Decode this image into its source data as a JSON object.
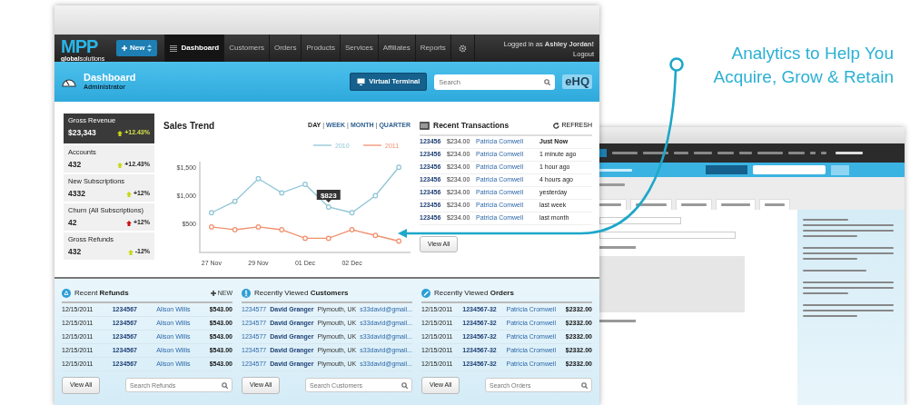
{
  "front_window": {
    "logo": {
      "mark": "MPP",
      "tagline": "**global**solutions"
    },
    "new_button": "New",
    "nav": [
      {
        "label": "Dashboard",
        "selected": true
      },
      {
        "label": "Customers",
        "selected": false
      },
      {
        "label": "Orders",
        "selected": false
      },
      {
        "label": "Products",
        "selected": false
      },
      {
        "label": "Services",
        "selected": false
      },
      {
        "label": "Affiliates",
        "selected": false
      },
      {
        "label": "Reports",
        "selected": false
      }
    ],
    "user": {
      "greeting": "Logged in as **Ashley Jordan!**",
      "logout": "Logout"
    },
    "header": {
      "title": "Dashboard",
      "subtitle": "Administrator",
      "terminal_button": "Virtual Terminal",
      "search_placeholder": "Search",
      "brand": "eHQ"
    },
    "stats": [
      {
        "label": "Gross Revenue",
        "value": "$23,343",
        "change": "+12.43%",
        "color": "#c8d814",
        "selected": true
      },
      {
        "label": "Accounts",
        "value": "432",
        "change": "+12.43%",
        "color": "#c8d814",
        "selected": false
      },
      {
        "label": "New Subscriptions",
        "value": "4332",
        "change": "+12%",
        "color": "#c8d814",
        "selected": false
      },
      {
        "label": "Churn (All Subscriptions)",
        "value": "42",
        "change": "+12%",
        "color": "#cc1111",
        "selected": false
      },
      {
        "label": "Gross Refunds",
        "value": "432",
        "change": "-12%",
        "color": "#c8d814",
        "selected": false
      }
    ],
    "sales_trend": {
      "title": "Sales Trend",
      "separator": "|",
      "periods": [
        {
          "label": "DAY",
          "selected": true
        },
        {
          "label": "WEEK",
          "selected": false
        },
        {
          "label": "MONTH",
          "selected": false
        },
        {
          "label": "QUARTER",
          "selected": false
        }
      ],
      "chart_data": {
        "type": "line",
        "categories": [
          "27 Nov",
          null,
          "29 Nov",
          null,
          "01 Dec",
          null,
          "02 Dec",
          null,
          null
        ],
        "ylim": [
          0,
          1600
        ],
        "legend": "upper right",
        "yticks": [
          {
            "value": 500,
            "label": "$500"
          },
          {
            "value": 1000,
            "label": "$1,000"
          },
          {
            "value": 1500,
            "label": "$1,500"
          }
        ],
        "series": [
          {
            "name": "2010",
            "color": "#8ec5d6",
            "marker": "circle",
            "values": [
              700,
              900,
              1300,
              1050,
              1200,
              800,
              700,
              1000,
              1500
            ]
          },
          {
            "name": "2011",
            "color": "#f0906e",
            "marker": "circle",
            "values": [
              450,
              400,
              450,
              400,
              250,
              250,
              400,
              300,
              200
            ]
          }
        ],
        "annotations": [
          "$823"
        ]
      }
    },
    "transactions": {
      "title": "Recent Transactions",
      "refresh": "REFRESH",
      "view_all": "View All",
      "rows": [
        {
          "id": "123456",
          "amount": "$234.00",
          "name": "Patricia Comwell",
          "time": "Just Now",
          "latest": true
        },
        {
          "id": "123456",
          "amount": "$234.00",
          "name": "Patricia Comwell",
          "time": "1 minute ago",
          "latest": false
        },
        {
          "id": "123456",
          "amount": "$234.00",
          "name": "Patricia Comwell",
          "time": "1 hour ago",
          "latest": false
        },
        {
          "id": "123456",
          "amount": "$234.00",
          "name": "Patricia Comwell",
          "time": "4 hours ago",
          "latest": false
        },
        {
          "id": "123456",
          "amount": "$234.00",
          "name": "Patricia Comwell",
          "time": "yesterday",
          "latest": false
        },
        {
          "id": "123456",
          "amount": "$234.00",
          "name": "Patricia Comwell",
          "time": "last week",
          "latest": false
        },
        {
          "id": "123456",
          "amount": "$234.00",
          "name": "Patricia Comwell",
          "time": "last month",
          "latest": false
        }
      ]
    },
    "panels": [
      {
        "kind": "refunds",
        "title": "Recent **Refunds**",
        "new_link": "NEW",
        "view_all": "View All",
        "search_placeholder": "Search Refunds",
        "rows": [
          [
            "12/15/2011",
            "1234567",
            "Alison Willis",
            "$543.00"
          ],
          [
            "12/15/2011",
            "1234567",
            "Alison Willis",
            "$543.00"
          ],
          [
            "12/15/2011",
            "1234567",
            "Alison Willis",
            "$543.00"
          ],
          [
            "12/15/2011",
            "1234567",
            "Alison Willis",
            "$543.00"
          ],
          [
            "12/15/2011",
            "1234567",
            "Alison Willis",
            "$543.00"
          ]
        ]
      },
      {
        "kind": "customers",
        "title": "Recently Viewed **Customers**",
        "view_all": "View All",
        "search_placeholder": "Search Customers",
        "rows": [
          [
            "1234577",
            "David Granger",
            "Plymouth, UK",
            "s33david@gmail..."
          ],
          [
            "1234577",
            "David Granger",
            "Plymouth, UK",
            "s33david@gmail..."
          ],
          [
            "1234577",
            "David Granger",
            "Plymouth, UK",
            "s33david@gmail..."
          ],
          [
            "1234577",
            "David Granger",
            "Plymouth, UK",
            "s33david@gmail..."
          ],
          [
            "1234577",
            "David Granger",
            "Plymouth, UK",
            "s33david@gmail..."
          ]
        ]
      },
      {
        "kind": "orders",
        "title": "Recently Viewed **Orders**",
        "view_all": "View All",
        "search_placeholder": "Search Orders",
        "rows": [
          [
            "12/15/2011",
            "1234567-32",
            "Patricia Cromwell",
            "$2332.00"
          ],
          [
            "12/15/2011",
            "1234567-32",
            "Patricia Cromwell",
            "$2332.00"
          ],
          [
            "12/15/2011",
            "1234567-32",
            "Patricia Cromwell",
            "$2332.00"
          ],
          [
            "12/15/2011",
            "1234567-32",
            "Patricia Cromwell",
            "$2332.00"
          ],
          [
            "12/15/2011",
            "1234567-32",
            "Patricia Cromwell",
            "$2332.00"
          ]
        ]
      }
    ]
  },
  "tagline": [
    "Analytics to Help You",
    "Acquire, Grow & Retain"
  ]
}
